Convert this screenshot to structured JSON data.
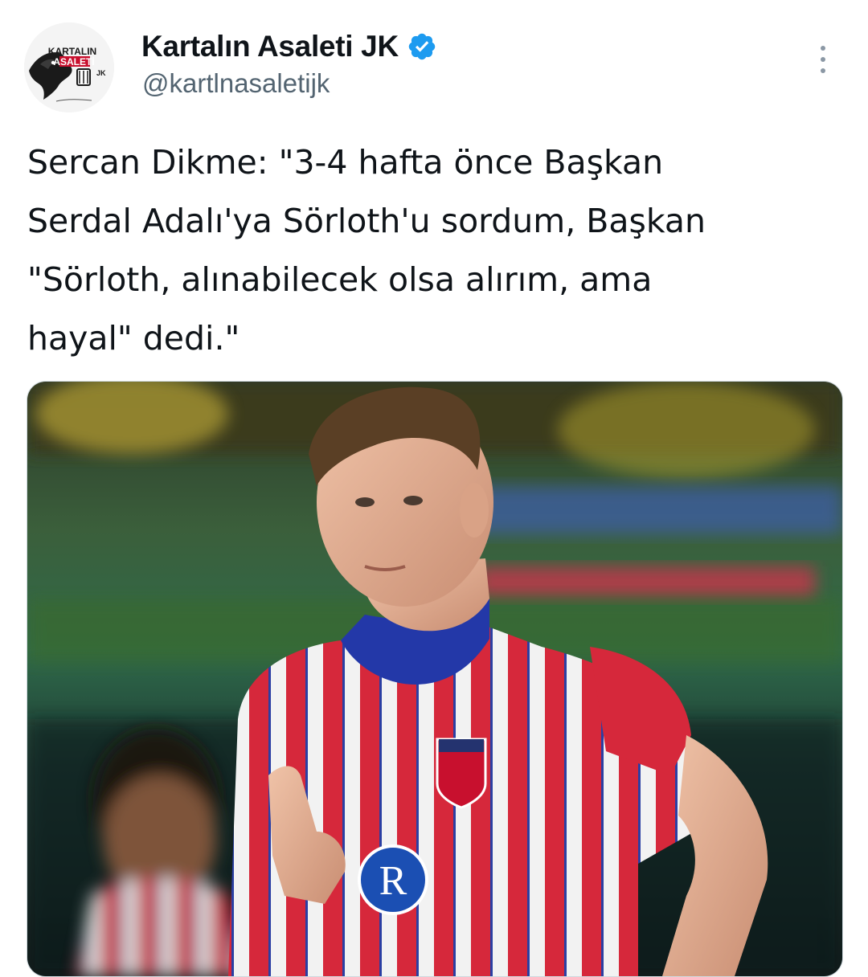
{
  "tweet": {
    "author": {
      "display_name": "Kartalın Asaleti JK",
      "handle": "@kartlnasaletijk",
      "verified": true,
      "avatar_logo_text": "KARTALIN ASALETİ JK"
    },
    "text": "Sercan Dikme: \"3-4 hafta önce Başkan\nSerdal Adalı'ya Sörloth'u sordum, Başkan\n\"Sörloth, alınabilecek olsa alırım, ama\nhayal\" dedi.\"",
    "media": {
      "type": "photo"
    }
  },
  "icons": {
    "verified": "verified-badge-icon",
    "more": "more-options-icon"
  },
  "colors": {
    "verified_blue": "#1d9bf0",
    "secondary_text": "#536471",
    "primary_text": "#0f1419"
  }
}
